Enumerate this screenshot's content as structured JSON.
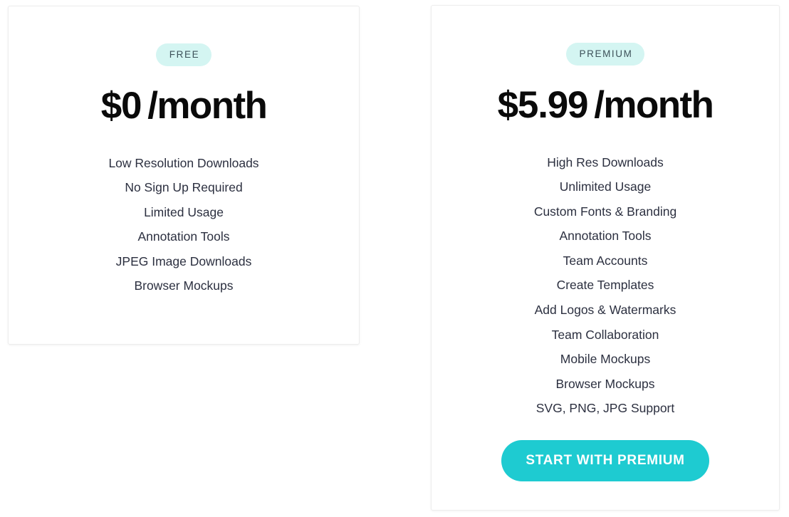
{
  "page": {
    "background_color": "#ffffff",
    "accent_color": "#1ecbd1",
    "badge_background_color": "#d4f5f2",
    "badge_text_color": "#3d5159",
    "feature_text_color": "#2c3040",
    "price_text_color": "#0a0a0a",
    "card_border_color": "#ededed"
  },
  "plans": [
    {
      "id": "free",
      "badge": "FREE",
      "price_amount": "$0",
      "price_period": "/month",
      "features": [
        "Low Resolution Downloads",
        "No Sign Up Required",
        "Limited Usage",
        "Annotation Tools",
        "JPEG Image Downloads",
        "Browser Mockups"
      ],
      "cta": null
    },
    {
      "id": "premium",
      "badge": "PREMIUM",
      "price_amount": "$5.99",
      "price_period": "/month",
      "features": [
        "High Res Downloads",
        "Unlimited Usage",
        "Custom Fonts & Branding",
        "Annotation Tools",
        "Team Accounts",
        "Create Templates",
        "Add Logos & Watermarks",
        "Team Collaboration",
        "Mobile Mockups",
        "Browser Mockups",
        "SVG, PNG, JPG Support"
      ],
      "cta": "START WITH PREMIUM"
    }
  ]
}
